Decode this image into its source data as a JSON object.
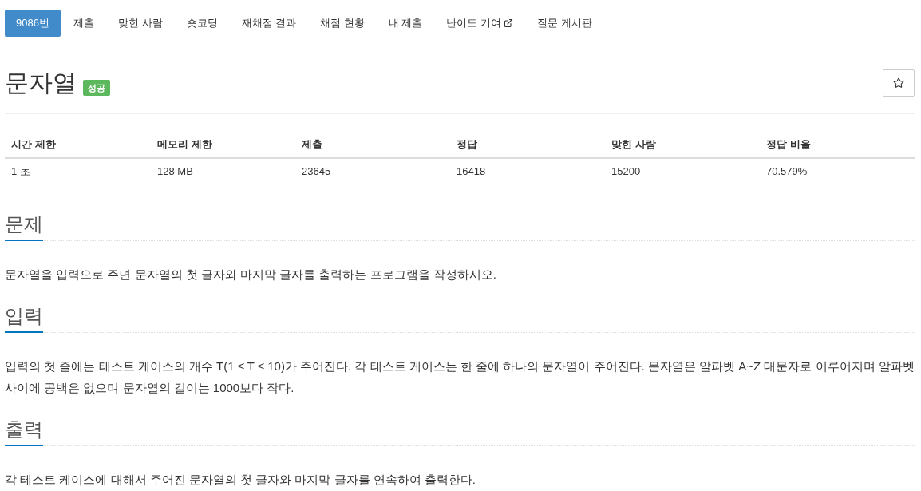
{
  "nav": {
    "tabs": [
      {
        "label": "9086번",
        "selected": true,
        "external": false
      },
      {
        "label": "제출",
        "selected": false,
        "external": false
      },
      {
        "label": "맞힌 사람",
        "selected": false,
        "external": false
      },
      {
        "label": "숏코딩",
        "selected": false,
        "external": false
      },
      {
        "label": "재채점 결과",
        "selected": false,
        "external": false
      },
      {
        "label": "채점 현황",
        "selected": false,
        "external": false
      },
      {
        "label": "내 제출",
        "selected": false,
        "external": false
      },
      {
        "label": "난이도 기여",
        "selected": false,
        "external": true
      },
      {
        "label": "질문 게시판",
        "selected": false,
        "external": false
      }
    ]
  },
  "problem": {
    "title": "문자열",
    "badge": "성공",
    "favorited": false
  },
  "stats": {
    "columns": [
      "시간 제한",
      "메모리 제한",
      "제출",
      "정답",
      "맞힌 사람",
      "정답 비율"
    ],
    "rows": [
      [
        "1 초",
        "128 MB",
        "23645",
        "16418",
        "15200",
        "70.579%"
      ]
    ]
  },
  "sections": [
    {
      "heading": "문제",
      "body": "문자열을 입력으로 주면 문자열의 첫 글자와 마지막 글자를 출력하는 프로그램을 작성하시오."
    },
    {
      "heading": "입력",
      "body": "입력의 첫 줄에는 테스트 케이스의 개수 T(1 ≤ T ≤ 10)가 주어진다. 각 테스트 케이스는 한 줄에 하나의 문자열이 주어진다. 문자열은 알파벳 A~Z 대문자로 이루어지며 알파벳 사이에 공백은 없으며 문자열의 길이는 1000보다 작다."
    },
    {
      "heading": "출력",
      "body": "각 테스트 케이스에 대해서 주어진 문자열의 첫 글자와 마지막 글자를 연속하여 출력한다."
    }
  ]
}
